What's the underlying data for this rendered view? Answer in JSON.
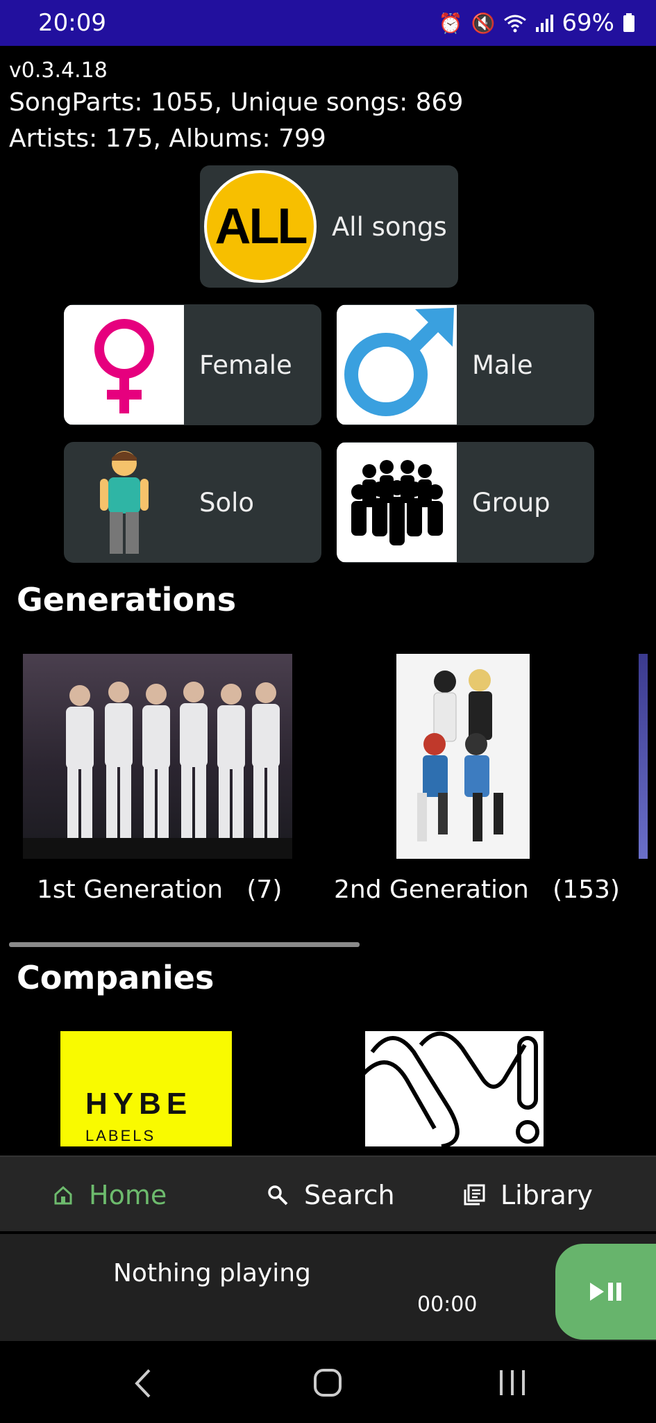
{
  "status_bar": {
    "time": "20:09",
    "battery": "69%"
  },
  "stats": {
    "version": "v0.3.4.18",
    "songs_line": "SongParts: 1055, Unique songs: 869",
    "artists_line": "Artists: 175,  Albums: 799"
  },
  "categories": {
    "all": {
      "badge": "ALL",
      "label": "All songs"
    },
    "female": {
      "label": "Female"
    },
    "male": {
      "label": "Male"
    },
    "solo": {
      "label": "Solo"
    },
    "group": {
      "label": "Group"
    }
  },
  "sections": {
    "generations": "Generations",
    "companies": "Companies"
  },
  "generations": [
    {
      "label": "1st Generation   (7)"
    },
    {
      "label": "2nd Generation   (153)"
    }
  ],
  "companies": {
    "hybe": {
      "name": "HYBE",
      "sub": "LABELS"
    }
  },
  "bottom_nav": {
    "home": "Home",
    "search": "Search",
    "library": "Library"
  },
  "player": {
    "title": "Nothing playing",
    "time": "00:00"
  },
  "colors": {
    "status_bar": "#22109e",
    "accent_green": "#6dbb6d",
    "play_button": "#67b46c",
    "hybe_yellow": "#f9fa00",
    "all_yellow": "#f7bf00"
  }
}
